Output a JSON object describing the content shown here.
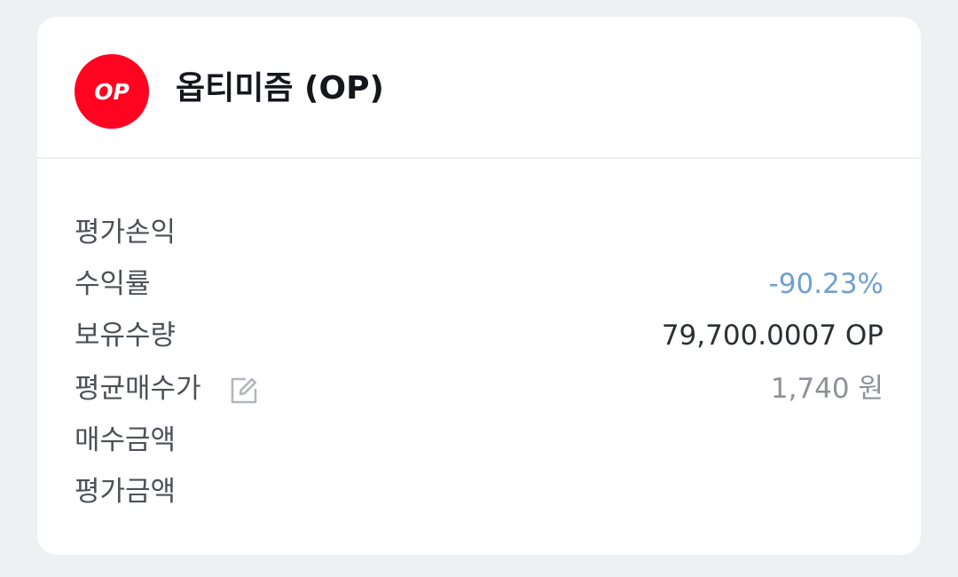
{
  "coin": {
    "logo_text": "OP",
    "title": "옵티미즘 (OP)",
    "logo_color": "#ff0420"
  },
  "rows": [
    {
      "label": "평가손익",
      "value": ""
    },
    {
      "label": "수익률",
      "value": "-90.23%",
      "value_color": "#6fa0cf"
    },
    {
      "label": "보유수량",
      "value": "79,700.0007 OP"
    },
    {
      "label": "평균매수가",
      "value": "1,740 원",
      "icon": "edit-icon"
    },
    {
      "label": "매수금액",
      "value": ""
    },
    {
      "label": "평가금액",
      "value": ""
    }
  ]
}
